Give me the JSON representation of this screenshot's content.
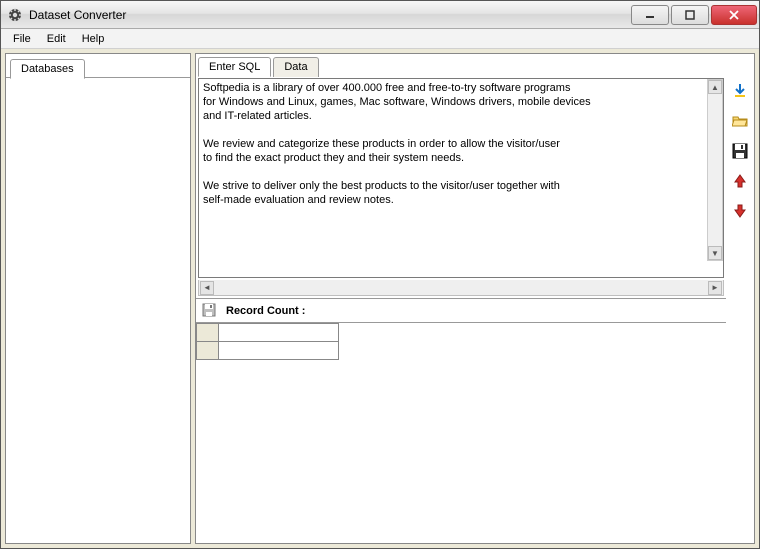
{
  "window": {
    "title": "Dataset Converter"
  },
  "menu": {
    "file": "File",
    "edit": "Edit",
    "help": "Help"
  },
  "left": {
    "tab_databases": "Databases"
  },
  "right": {
    "tab_enter_sql": "Enter SQL",
    "tab_data": "Data",
    "sql_text": "Softpedia is a library of over 400.000 free and free-to-try software programs\nfor Windows and Linux, games, Mac software, Windows drivers, mobile devices\nand IT-related articles.\n\nWe review and categorize these products in order to allow the visitor/user\nto find the exact product they and their system needs.\n\nWe strive to deliver only the best products to the visitor/user together with\nself-made evaluation and review notes."
  },
  "result": {
    "label": "Record Count :",
    "value": ""
  },
  "icons": {
    "app": "gear-icon",
    "download": "download-icon",
    "open": "open-folder-icon",
    "save": "save-icon",
    "up": "arrow-up-icon",
    "down": "arrow-down-icon"
  }
}
